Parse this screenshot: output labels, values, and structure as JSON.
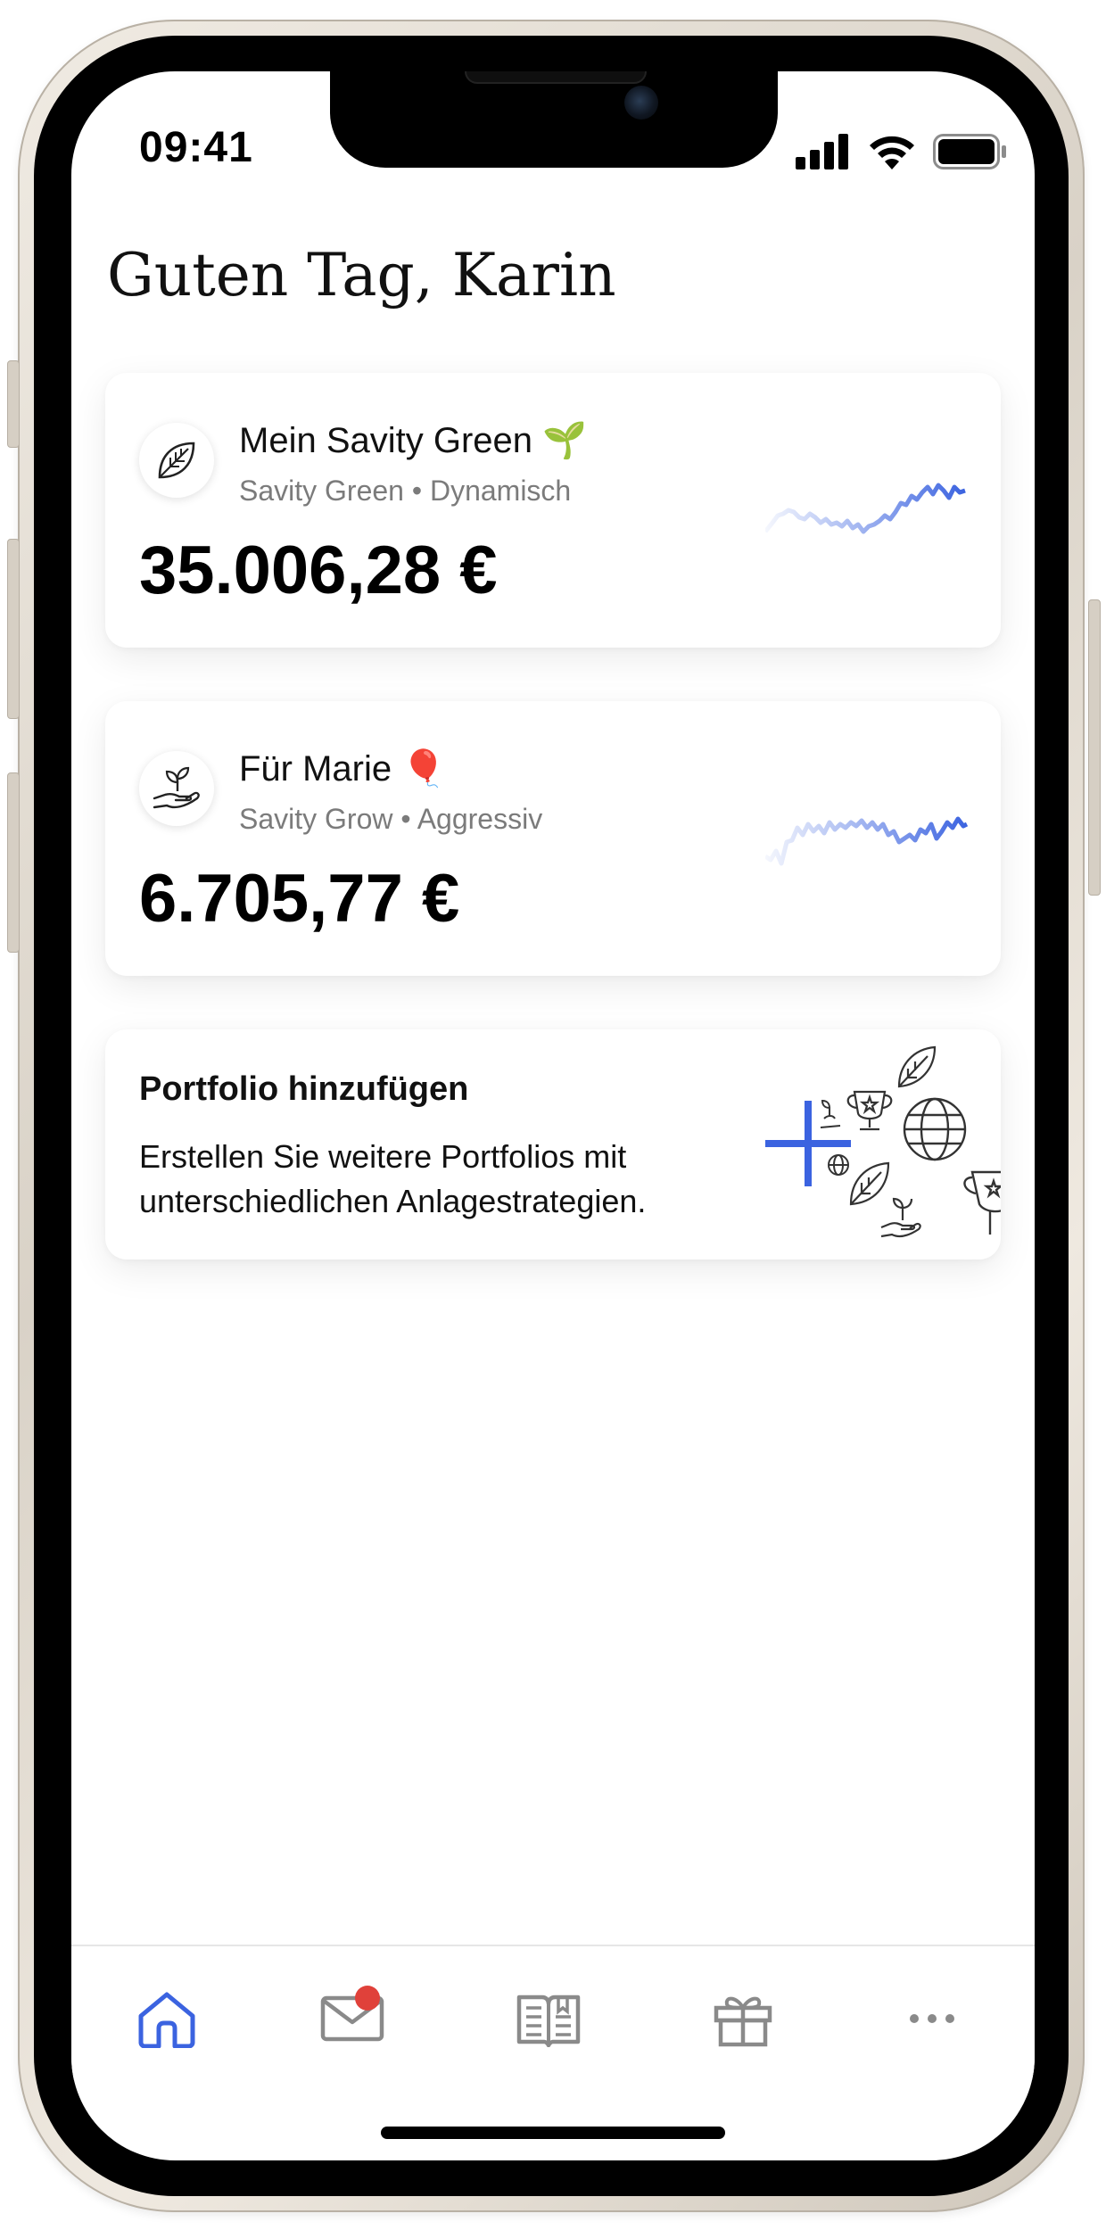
{
  "status_bar": {
    "time": "09:41"
  },
  "greeting": "Guten Tag, Karin",
  "portfolios": [
    {
      "name": "Mein Savity Green",
      "emoji": "🌱",
      "subtitle": "Savity Green • Dynamisch",
      "value": "35.006,28 €",
      "icon": "leaf-icon"
    },
    {
      "name": "Für Marie",
      "emoji": "🎈",
      "subtitle": "Savity Grow • Aggressiv",
      "value": "6.705,77 €",
      "icon": "hand-sprout-icon"
    }
  ],
  "add_portfolio": {
    "title": "Portfolio hinzufügen",
    "description": "Erstellen Sie weitere Portfolios mit unterschiedlichen Anlagestrategien."
  },
  "tabbar": {
    "items": [
      {
        "icon": "home-icon",
        "active": true
      },
      {
        "icon": "mail-icon",
        "badge": true
      },
      {
        "icon": "book-icon"
      },
      {
        "icon": "gift-icon"
      },
      {
        "icon": "more-icon"
      }
    ]
  },
  "colors": {
    "accent": "#3b63e0",
    "badge": "#e0413a",
    "text_secondary": "#7b7b7b"
  }
}
